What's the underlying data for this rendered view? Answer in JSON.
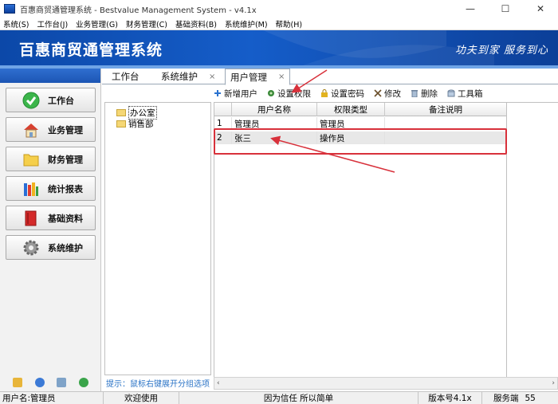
{
  "window": {
    "title": "百惠商贸通管理系统 - Bestvalue Management System - v4.1x",
    "controls": [
      "—",
      "☐",
      "✕"
    ]
  },
  "menu": [
    "系统(S)",
    "工作台(J)",
    "业务管理(G)",
    "财务管理(C)",
    "基础资料(B)",
    "系统维护(M)",
    "帮助(H)"
  ],
  "banner": {
    "title": "百惠商贸通管理系统",
    "slogan": "功夫到家 服务到心"
  },
  "nav": [
    {
      "label": "工作台",
      "icon": "check-icon"
    },
    {
      "label": "业务管理",
      "icon": "house-icon"
    },
    {
      "label": "财务管理",
      "icon": "folder-icon"
    },
    {
      "label": "统计报表",
      "icon": "books-icon"
    },
    {
      "label": "基础资料",
      "icon": "book-icon"
    },
    {
      "label": "系统维护",
      "icon": "gear-icon"
    }
  ],
  "tabs": [
    {
      "label": "工作台"
    },
    {
      "label": "系统维护",
      "close": "×"
    },
    {
      "label": "用户管理",
      "close": "×"
    }
  ],
  "toolbar": [
    {
      "label": "新增用户",
      "icon": "plus-icon",
      "color": "#2a72cf"
    },
    {
      "label": "设置权限",
      "icon": "permission-icon",
      "color": "#3c8a3a"
    },
    {
      "label": "设置密码",
      "icon": "lock-icon",
      "color": "#e2b320"
    },
    {
      "label": "修改",
      "icon": "edit-icon",
      "color": "#6b4f2a"
    },
    {
      "label": "删除",
      "icon": "trash-icon",
      "color": "#7a8fa8"
    },
    {
      "label": "工具箱",
      "icon": "toolbox-icon",
      "color": "#7a8fa8"
    }
  ],
  "tree": [
    {
      "label": "办公室",
      "selected": true
    },
    {
      "label": "销售部",
      "selected": false
    }
  ],
  "hint": "提示：鼠标右键展开分组选项",
  "table": {
    "columns": [
      "",
      "用户名称",
      "权限类型",
      "备注说明"
    ],
    "rows": [
      {
        "no": "1",
        "name": "管理员",
        "role": "管理员",
        "note": ""
      },
      {
        "no": "2",
        "name": "张三",
        "role": "操作员",
        "note": ""
      }
    ]
  },
  "scroll": {
    "left": "‹",
    "right": "›"
  },
  "status": {
    "user": "用户名:管理员",
    "welcome": "欢迎使用",
    "slogan": "因为信任 所以简单",
    "version": "版本号4.1x",
    "server": "服务端",
    "server_value": "55"
  },
  "colors": {
    "banner": "#1252b8",
    "annotation": "#d8313b",
    "hint": "#2a73c6"
  }
}
